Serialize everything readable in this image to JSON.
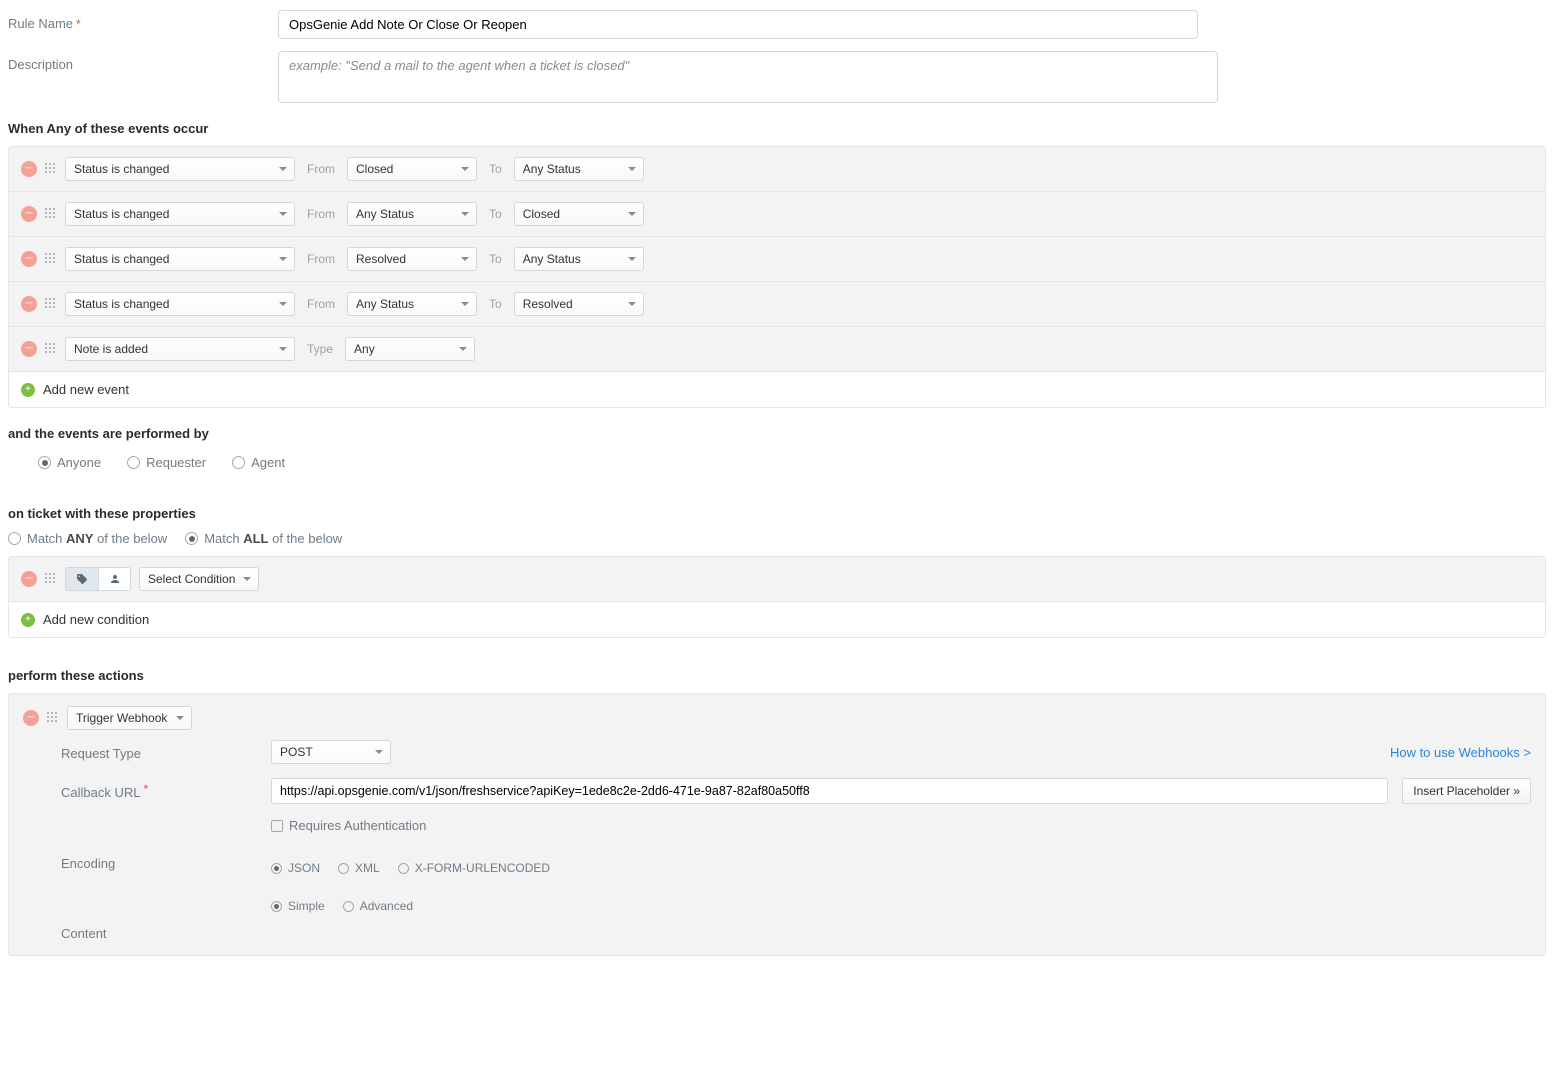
{
  "labels": {
    "rule_name": "Rule Name",
    "description": "Description",
    "events_heading": "When Any of these events occur",
    "from": "From",
    "to": "To",
    "type": "Type",
    "add_event": "Add new event",
    "performed_by": "and the events are performed by",
    "perf_anyone": "Anyone",
    "perf_requester": "Requester",
    "perf_agent": "Agent",
    "ticket_props": "on ticket with these properties",
    "match_any_prefix": "Match ",
    "match_any_suffix": " of the below",
    "match_any_bold": "ANY",
    "match_all_bold": "ALL",
    "add_condition": "Add new condition",
    "perform_actions": "perform these actions",
    "request_type": "Request Type",
    "callback_url": "Callback URL",
    "requires_auth": "Requires Authentication",
    "encoding": "Encoding",
    "enc_json": "JSON",
    "enc_xml": "XML",
    "enc_form": "X-FORM-URLENCODED",
    "simple": "Simple",
    "advanced": "Advanced",
    "content": "Content",
    "insert_placeholder": "Insert Placeholder »",
    "webhook_help": "How to use Webhooks >"
  },
  "form": {
    "rule_name": "OpsGenie Add Note Or Close Or Reopen",
    "description_placeholder": "example: \"Send a mail to the agent when a ticket is closed\""
  },
  "events": [
    {
      "type": "Status is changed",
      "from": "Closed",
      "to": "Any Status"
    },
    {
      "type": "Status is changed",
      "from": "Any Status",
      "to": "Closed"
    },
    {
      "type": "Status is changed",
      "from": "Resolved",
      "to": "Any Status"
    },
    {
      "type": "Status is changed",
      "from": "Any Status",
      "to": "Resolved"
    },
    {
      "type": "Note is added",
      "extraLabel": "Type",
      "extraValue": "Any"
    }
  ],
  "condition_placeholder": "Select Condition",
  "action": {
    "type": "Trigger Webhook",
    "request_type": "POST",
    "callback_url": "https://api.opsgenie.com/v1/json/freshservice?apiKey=1ede8c2e-2dd6-471e-9a87-82af80a50ff8"
  }
}
